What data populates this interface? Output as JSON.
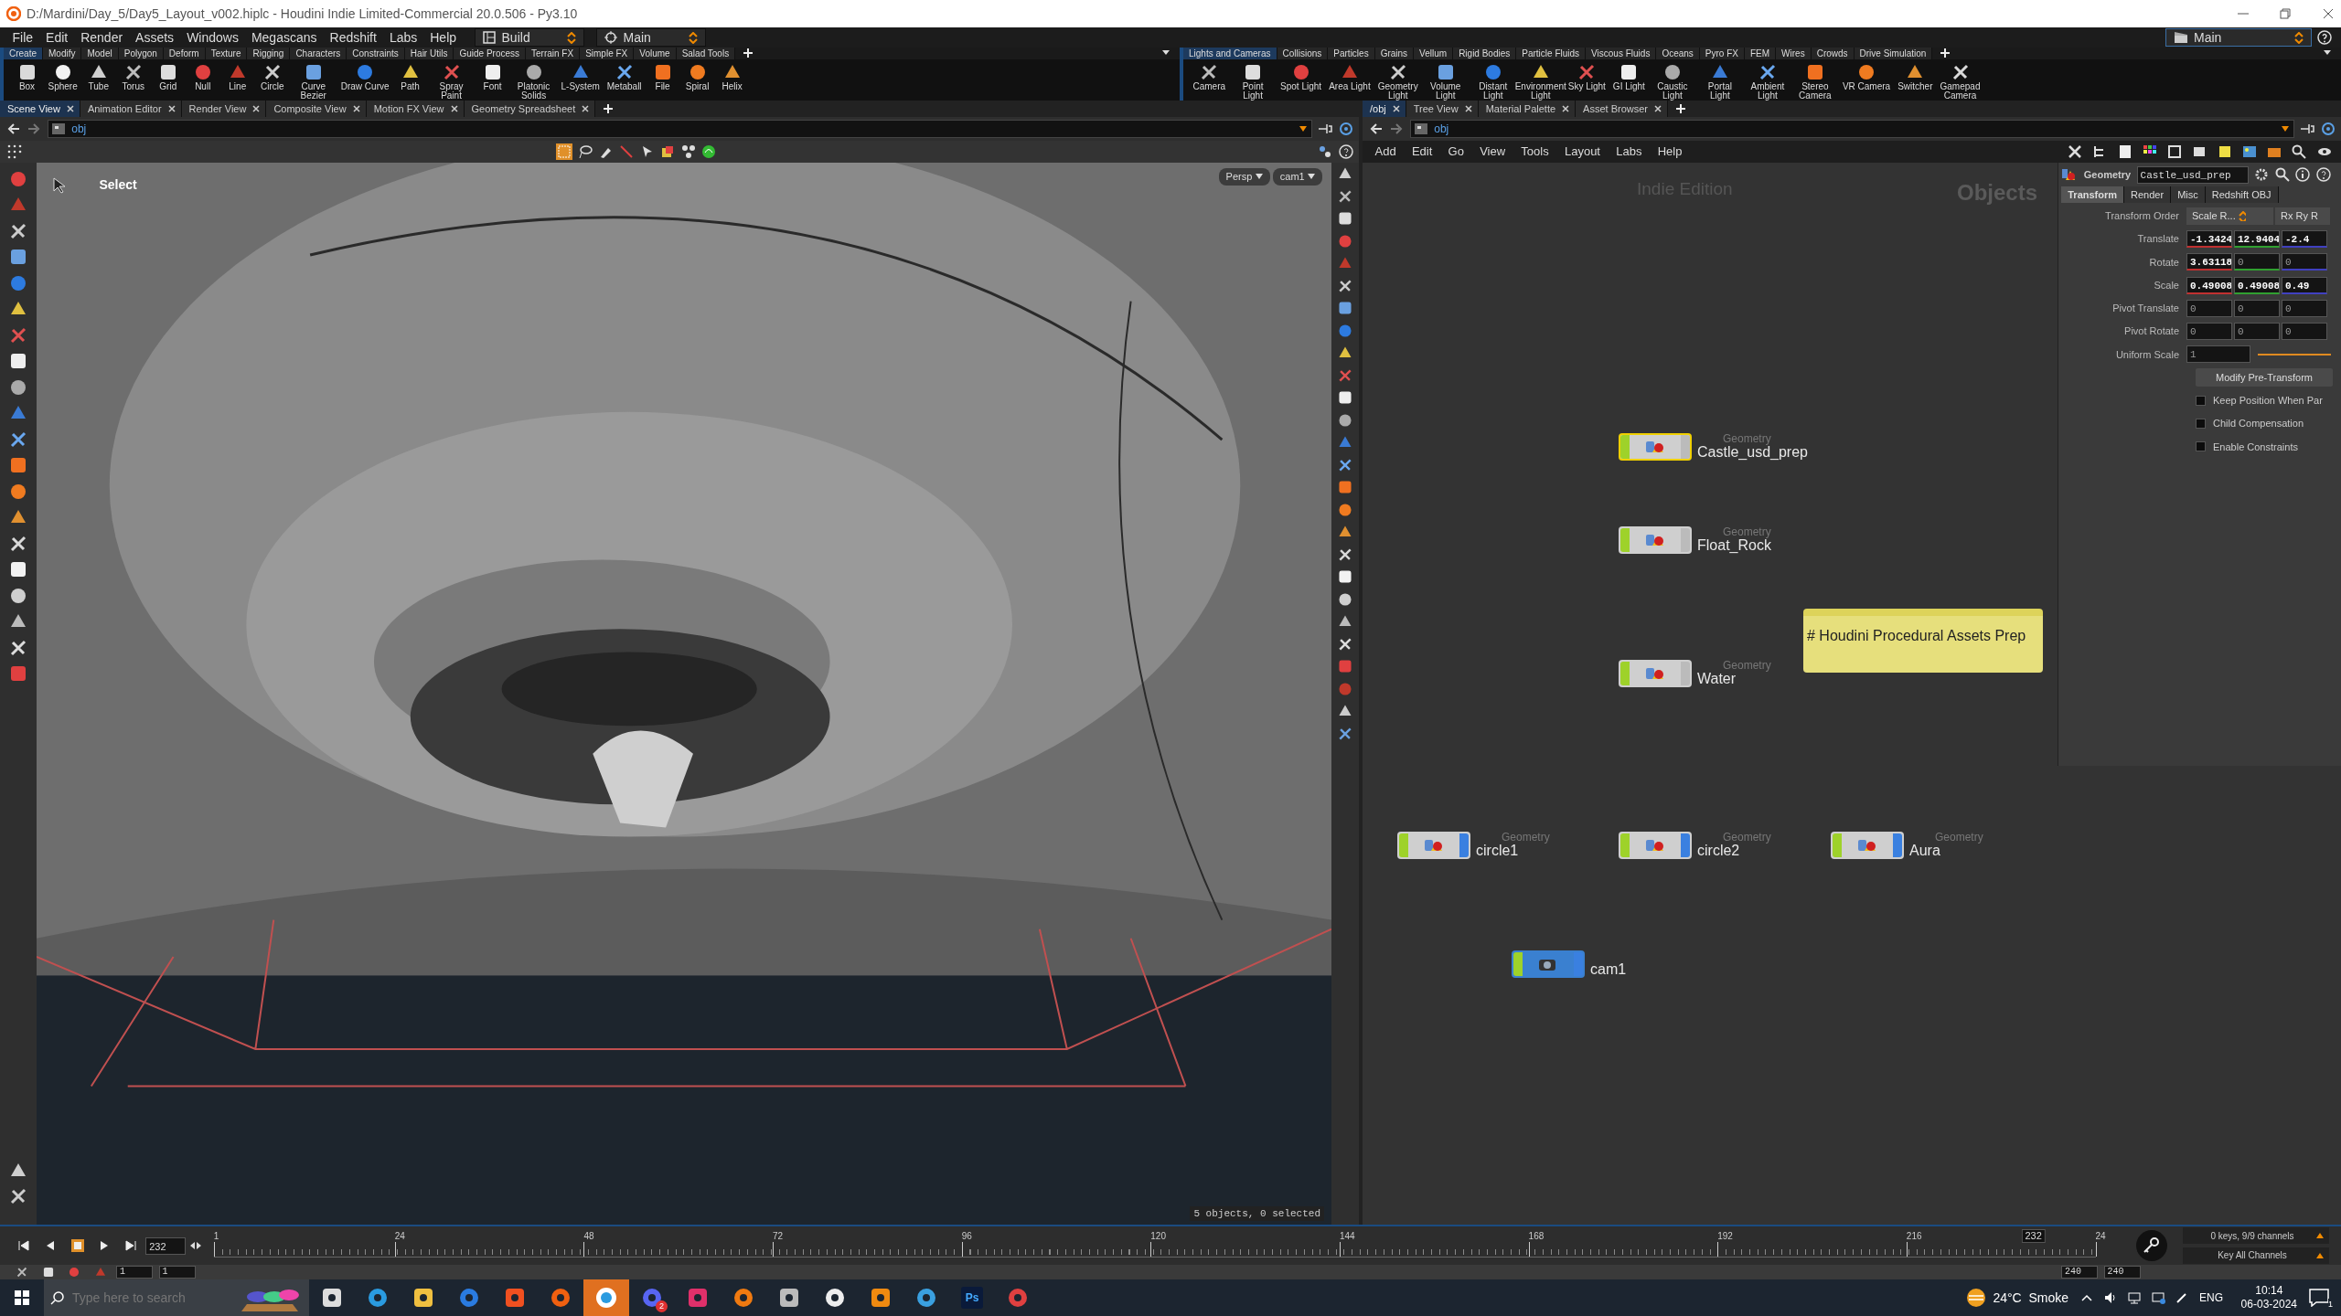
{
  "window": {
    "title": "D:/Mardini/Day_5/Day5_Layout_v002.hiplc - Houdini Indie Limited-Commercial 20.0.506 - Py3.10"
  },
  "menu": [
    "File",
    "Edit",
    "Render",
    "Assets",
    "Windows",
    "Megascans",
    "Redshift",
    "Labs",
    "Help"
  ],
  "desktops": [
    {
      "label": "Build"
    },
    {
      "label": "Main"
    }
  ],
  "right_desktop": "Main",
  "shelf_left": {
    "tabs": [
      {
        "label": "Create",
        "selected": true
      },
      {
        "label": "Modify",
        "selected": false
      },
      {
        "label": "Model",
        "selected": false
      },
      {
        "label": "Polygon",
        "selected": false
      },
      {
        "label": "Deform",
        "selected": false
      },
      {
        "label": "Texture",
        "selected": false
      },
      {
        "label": "Rigging",
        "selected": false
      },
      {
        "label": "Characters",
        "selected": false
      },
      {
        "label": "Constraints",
        "selected": false
      },
      {
        "label": "Hair Utils",
        "selected": false
      },
      {
        "label": "Guide Process",
        "selected": false
      },
      {
        "label": "Terrain FX",
        "selected": false
      },
      {
        "label": "Simple FX",
        "selected": false
      },
      {
        "label": "Volume",
        "selected": false
      },
      {
        "label": "Salad Tools",
        "selected": false
      }
    ],
    "tools": [
      "Box",
      "Sphere",
      "Tube",
      "Torus",
      "Grid",
      "Null",
      "Line",
      "Circle",
      "Curve Bezier",
      "Draw Curve",
      "Path",
      "Spray Paint",
      "Font",
      "Platonic Solids",
      "L-System",
      "Metaball",
      "File",
      "Spiral",
      "Helix"
    ]
  },
  "shelf_right": {
    "tabs": [
      {
        "label": "Lights and Cameras",
        "selected": true
      },
      {
        "label": "Collisions",
        "selected": false
      },
      {
        "label": "Particles",
        "selected": false
      },
      {
        "label": "Grains",
        "selected": false
      },
      {
        "label": "Vellum",
        "selected": false
      },
      {
        "label": "Rigid Bodies",
        "selected": false
      },
      {
        "label": "Particle Fluids",
        "selected": false
      },
      {
        "label": "Viscous Fluids",
        "selected": false
      },
      {
        "label": "Oceans",
        "selected": false
      },
      {
        "label": "Pyro FX",
        "selected": false
      },
      {
        "label": "FEM",
        "selected": false
      },
      {
        "label": "Wires",
        "selected": false
      },
      {
        "label": "Crowds",
        "selected": false
      },
      {
        "label": "Drive Simulation",
        "selected": false
      }
    ],
    "tools": [
      "Camera",
      "Point Light",
      "Spot Light",
      "Area Light",
      "Geometry Light",
      "Volume Light",
      "Distant Light",
      "Environment Light",
      "Sky Light",
      "GI Light",
      "Caustic Light",
      "Portal Light",
      "Ambient Light",
      "Stereo Camera",
      "VR Camera",
      "Switcher",
      "Gamepad Camera"
    ]
  },
  "left_pane": {
    "tabs": [
      {
        "label": "Scene View",
        "selected": true
      },
      {
        "label": "Animation Editor",
        "selected": false
      },
      {
        "label": "Render View",
        "selected": false
      },
      {
        "label": "Composite View",
        "selected": false
      },
      {
        "label": "Motion FX View",
        "selected": false
      },
      {
        "label": "Geometry Spreadsheet",
        "selected": false
      }
    ],
    "path": "obj",
    "tool_label": "Select",
    "view_menu": "Persp",
    "camera_menu": "cam1",
    "status": "5 objects, 0 selected"
  },
  "right_pane": {
    "tabs": [
      {
        "label": "/obj",
        "selected": true
      },
      {
        "label": "Tree View",
        "selected": false
      },
      {
        "label": "Material Palette",
        "selected": false
      },
      {
        "label": "Asset Browser",
        "selected": false
      }
    ],
    "path": "obj",
    "menu": [
      "Add",
      "Edit",
      "Go",
      "View",
      "Tools",
      "Layout",
      "Labs",
      "Help"
    ],
    "edition": "Indie Edition",
    "context": "Objects",
    "nodes": [
      {
        "kind": "geometry",
        "type": "Geometry",
        "name": "Castle_usd_prep",
        "selected": true,
        "display": false
      },
      {
        "kind": "geometry",
        "type": "Geometry",
        "name": "Float_Rock",
        "selected": false,
        "display": false
      },
      {
        "kind": "geometry",
        "type": "Geometry",
        "name": "Water",
        "selected": false,
        "display": false
      },
      {
        "kind": "geometry",
        "type": "Geometry",
        "name": "circle1",
        "selected": false,
        "display": true
      },
      {
        "kind": "geometry",
        "type": "Geometry",
        "name": "circle2",
        "selected": false,
        "display": true
      },
      {
        "kind": "geometry",
        "type": "Geometry",
        "name": "Aura",
        "selected": false,
        "display": true
      },
      {
        "kind": "camera",
        "name": "cam1",
        "selected": false,
        "display": true
      }
    ],
    "sticky_note": "# Houdini Procedural Assets Prep",
    "parameters": {
      "type": "Geometry",
      "name": "Castle_usd_prep",
      "tabs": [
        {
          "label": "Transform",
          "selected": true
        },
        {
          "label": "Render",
          "selected": false
        },
        {
          "label": "Misc",
          "selected": false
        },
        {
          "label": "Redshift OBJ",
          "selected": false
        }
      ],
      "rows": [
        {
          "kind": "menu",
          "label": "Transform Order",
          "values": [
            "Scale R...",
            "Rx Ry R"
          ]
        },
        {
          "kind": "vector",
          "label": "Translate",
          "axis_colored": true,
          "values": [
            {
              "text": "-1.3424",
              "modified": true
            },
            {
              "text": "12.9404",
              "modified": true
            },
            {
              "text": "-2.4",
              "modified": true
            }
          ]
        },
        {
          "kind": "vector",
          "label": "Rotate",
          "axis_colored": true,
          "values": [
            {
              "text": "3.63118",
              "modified": true
            },
            {
              "text": "0",
              "modified": false
            },
            {
              "text": "0",
              "modified": false
            }
          ]
        },
        {
          "kind": "vector",
          "label": "Scale",
          "axis_colored": true,
          "values": [
            {
              "text": "0.49008",
              "modified": true
            },
            {
              "text": "0.49008",
              "modified": true
            },
            {
              "text": "0.49",
              "modified": true
            }
          ]
        },
        {
          "kind": "vector",
          "label": "Pivot Translate",
          "axis_colored": false,
          "values": [
            {
              "text": "0",
              "modified": false
            },
            {
              "text": "0",
              "modified": false
            },
            {
              "text": "0",
              "modified": false
            }
          ]
        },
        {
          "kind": "vector",
          "label": "Pivot Rotate",
          "axis_colored": false,
          "values": [
            {
              "text": "0",
              "modified": false
            },
            {
              "text": "0",
              "modified": false
            },
            {
              "text": "0",
              "modified": false
            }
          ]
        },
        {
          "kind": "slider",
          "label": "Uniform Scale",
          "values": [
            {
              "text": "1",
              "modified": false
            }
          ]
        },
        {
          "kind": "button",
          "label": "Modify Pre-Transform"
        },
        {
          "kind": "checkbox",
          "label": "Keep Position When Par",
          "checked": false
        },
        {
          "kind": "checkbox",
          "label": "Child Compensation",
          "checked": false
        },
        {
          "kind": "checkbox",
          "label": "Enable Constraints",
          "checked": false
        }
      ]
    }
  },
  "timeline": {
    "frame": "232",
    "ticks": [
      "1",
      "24",
      "48",
      "72",
      "96",
      "120",
      "144",
      "168",
      "192",
      "216",
      "24"
    ],
    "playhead": "232",
    "level": 0.967,
    "range": [
      "1",
      "1",
      "240",
      "240"
    ],
    "keys": "0 keys, 9/9 channels",
    "key_mode": "Key All Channels"
  },
  "taskbar": {
    "search_placeholder": "Type here to search",
    "apps": [
      {
        "kind": "taskview",
        "selected": false
      },
      {
        "kind": "edge",
        "selected": false
      },
      {
        "kind": "folder",
        "selected": false
      },
      {
        "kind": "todo",
        "selected": false
      },
      {
        "kind": "brave",
        "selected": false
      },
      {
        "kind": "houdini",
        "selected": false
      },
      {
        "kind": "w",
        "selected": true
      },
      {
        "kind": "discord",
        "selected": false,
        "badge": "2"
      },
      {
        "kind": "bookmark",
        "selected": false
      },
      {
        "kind": "houdini2",
        "selected": false
      },
      {
        "kind": "monitor",
        "selected": false
      },
      {
        "kind": "loop",
        "selected": false
      },
      {
        "kind": "magnifier",
        "selected": false
      },
      {
        "kind": "photos",
        "selected": false
      },
      {
        "kind": "ps",
        "selected": false,
        "label": "Ps"
      },
      {
        "kind": "snip",
        "selected": false
      }
    ],
    "weather": "24°C  Smoke",
    "language": "ENG",
    "time": "10:14",
    "date": "06-03-2024",
    "notifications": "1"
  }
}
